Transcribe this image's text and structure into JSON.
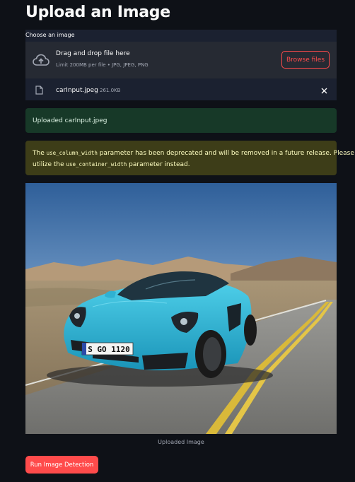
{
  "page": {
    "title": "Upload an Image"
  },
  "uploader": {
    "label": "Choose an image",
    "drop_title": "Drag and drop file here",
    "drop_subtitle": "Limit 200MB per file • JPG, JPEG, PNG",
    "browse_label": "Browse files",
    "icon": "cloud-upload-icon",
    "file": {
      "name": "carInput.jpeg",
      "size": "261.0KB",
      "icon": "file-icon"
    }
  },
  "alerts": {
    "success": "Uploaded carInput.jpeg",
    "warning": {
      "line1_a": "The ",
      "line1_code": "use_column_width",
      "line1_b": " parameter has been deprecated and will be removed in a future release. Please",
      "line2_a": "utilize the ",
      "line2_code": "use_container_width",
      "line2_b": " parameter instead."
    }
  },
  "image": {
    "caption": "Uploaded Image",
    "license_plate": "S GO 1120"
  },
  "actions": {
    "run_label": "Run Image Detection"
  },
  "colors": {
    "accent": "#ff4b4b",
    "background": "#0e1117",
    "success_bg": "#173928",
    "warning_bg": "#3d3d18"
  }
}
